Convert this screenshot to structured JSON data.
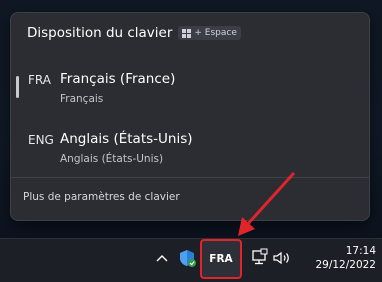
{
  "flyout": {
    "title": "Disposition du clavier",
    "shortcut_label": "+ Espace",
    "languages": [
      {
        "code": "FRA",
        "name": "Français (France)",
        "layout": "Français",
        "selected": true
      },
      {
        "code": "ENG",
        "name": "Anglais (États-Unis)",
        "layout": "Anglais (États-Unis)",
        "selected": false
      }
    ],
    "more_settings": "Plus de paramètres de clavier"
  },
  "taskbar": {
    "language_indicator": "FRA",
    "time": "17:14",
    "date": "29/12/2022",
    "icons": [
      "chevron-up-icon",
      "windows-security-icon",
      "network-icon",
      "volume-icon"
    ]
  },
  "colors": {
    "flyout_bg": "#2b2d33",
    "taskbar_bg": "#1c1f26",
    "annotation_red": "#e0242a"
  }
}
